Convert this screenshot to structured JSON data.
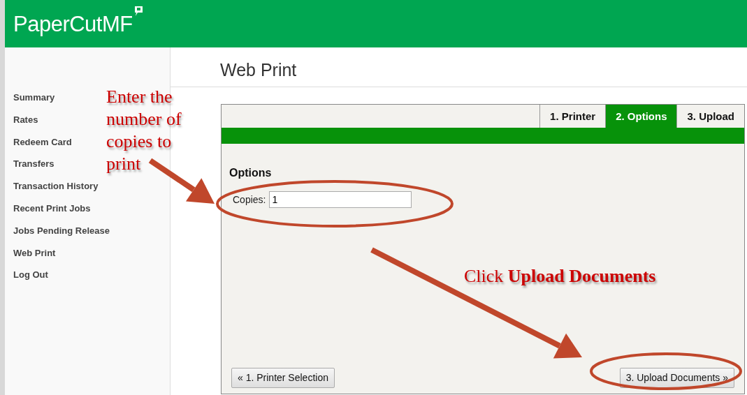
{
  "header": {
    "logo": "PaperCut",
    "logo_suffix": "MF"
  },
  "sidebar": {
    "items": [
      {
        "label": "Summary"
      },
      {
        "label": "Rates"
      },
      {
        "label": "Redeem Card"
      },
      {
        "label": "Transfers"
      },
      {
        "label": "Transaction History"
      },
      {
        "label": "Recent Print Jobs"
      },
      {
        "label": "Jobs Pending Release"
      },
      {
        "label": "Web Print"
      },
      {
        "label": "Log Out"
      }
    ]
  },
  "page_title": "Web Print",
  "wizard": {
    "tabs": [
      {
        "label": "1. Printer",
        "selected": false
      },
      {
        "label": "2. Options",
        "selected": true
      },
      {
        "label": "3. Upload",
        "selected": false
      }
    ],
    "section_title": "Options",
    "copies": {
      "label": "Copies:",
      "value": "1"
    },
    "buttons": [
      {
        "label": "« 1. Printer Selection",
        "kind": "back"
      },
      {
        "label": "3. Upload Documents »",
        "kind": "next"
      }
    ]
  },
  "annotations": [
    {
      "text": "Enter the number of copies to print",
      "kind": "copies"
    },
    {
      "text": "Click **Upload Documents**",
      "kind": "upload"
    }
  ]
}
